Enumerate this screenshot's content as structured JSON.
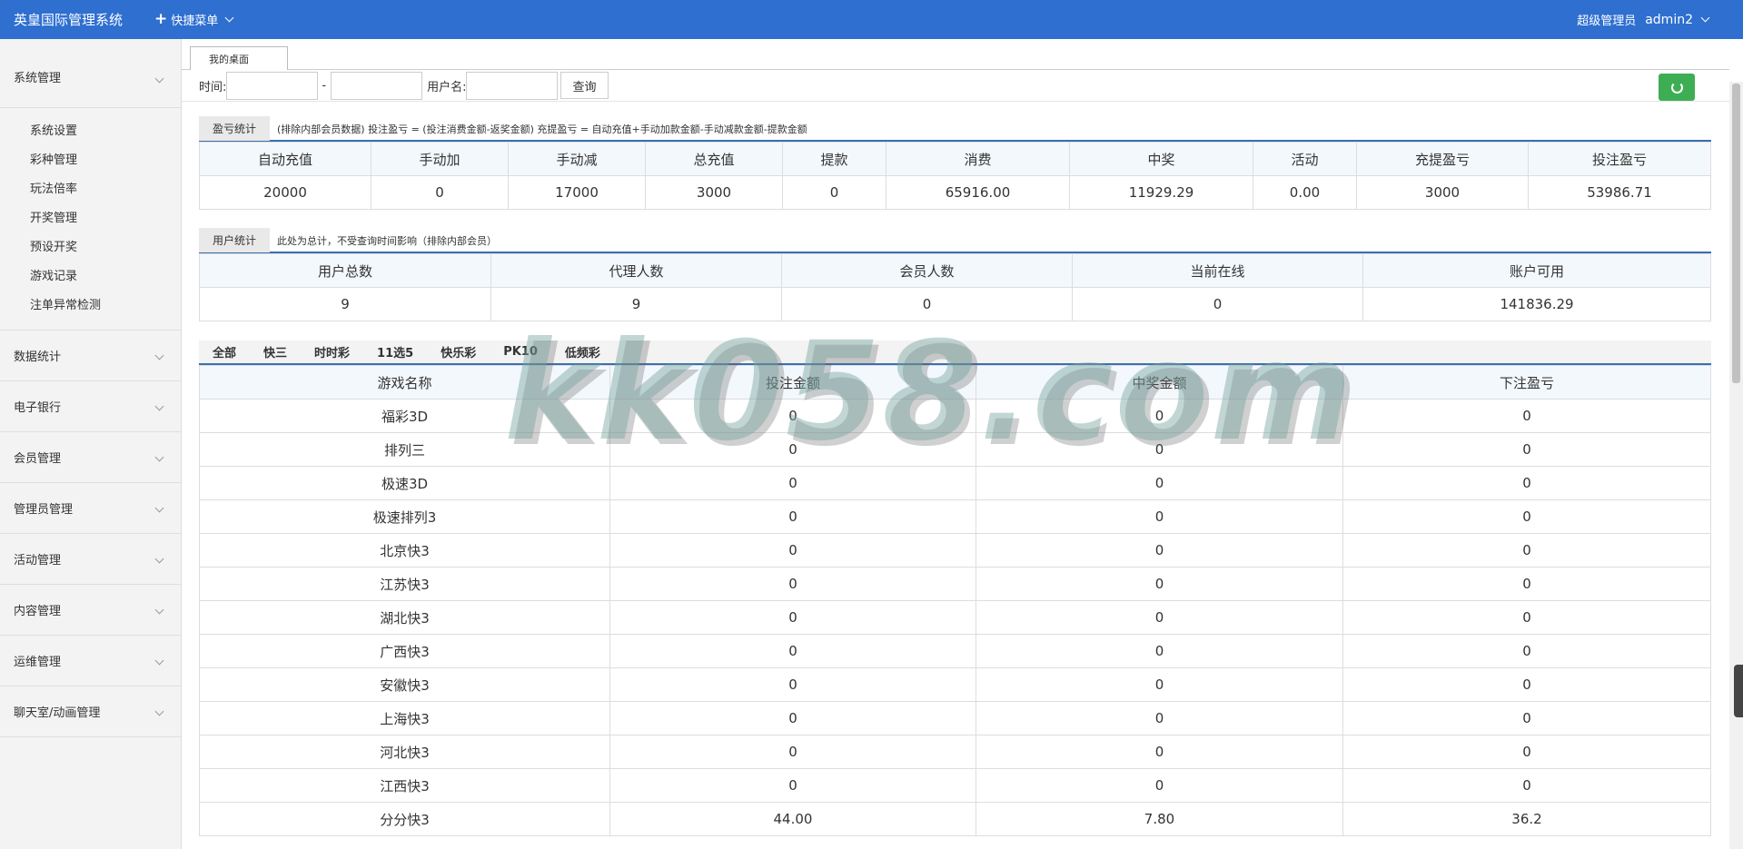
{
  "app": {
    "title": "英皇国际管理系统",
    "quick_menu": "快捷菜单",
    "role": "超级管理员",
    "user": "admin2"
  },
  "sidebar": {
    "groups": [
      "系统管理",
      "数据统计",
      "电子银行",
      "会员管理",
      "管理员管理",
      "活动管理",
      "内容管理",
      "运维管理",
      "聊天室/动画管理"
    ],
    "sub_items": [
      "系统设置",
      "彩种管理",
      "玩法倍率",
      "开奖管理",
      "预设开奖",
      "游戏记录",
      "注单异常检测"
    ]
  },
  "tab": {
    "label": "我的桌面"
  },
  "filter": {
    "time_label": "时间:",
    "dash": "-",
    "user_label": "用户名:",
    "query_button": "查询"
  },
  "profit": {
    "label": "盈亏统计",
    "note": "(排除内部会员数据)  投注盈亏 = (投注消费金额-返奖金额)    充提盈亏 = 自动充值+手动加款金额-手动减款金额-提款金额",
    "headers": [
      "自动充值",
      "手动加",
      "手动减",
      "总充值",
      "提款",
      "消费",
      "中奖",
      "活动",
      "充提盈亏",
      "投注盈亏"
    ],
    "values": [
      "20000",
      "0",
      "17000",
      "3000",
      "0",
      "65916.00",
      "11929.29",
      "0.00",
      "3000",
      "53986.71"
    ]
  },
  "users": {
    "label": "用户统计",
    "note": "此处为总计，不受查询时间影响（排除内部会员）",
    "headers": [
      "用户总数",
      "代理人数",
      "会员人数",
      "当前在线",
      "账户可用"
    ],
    "values": [
      "9",
      "9",
      "0",
      "0",
      "141836.29"
    ]
  },
  "game_tabs": [
    "全部",
    "快三",
    "时时彩",
    "11选5",
    "快乐彩",
    "PK10",
    "低频彩"
  ],
  "games": {
    "headers": [
      "游戏名称",
      "投注金额",
      "中奖金额",
      "下注盈亏"
    ],
    "rows": [
      [
        "福彩3D",
        "0",
        "0",
        "0"
      ],
      [
        "排列三",
        "0",
        "0",
        "0"
      ],
      [
        "极速3D",
        "0",
        "0",
        "0"
      ],
      [
        "极速排列3",
        "0",
        "0",
        "0"
      ],
      [
        "北京快3",
        "0",
        "0",
        "0"
      ],
      [
        "江苏快3",
        "0",
        "0",
        "0"
      ],
      [
        "湖北快3",
        "0",
        "0",
        "0"
      ],
      [
        "广西快3",
        "0",
        "0",
        "0"
      ],
      [
        "安徽快3",
        "0",
        "0",
        "0"
      ],
      [
        "上海快3",
        "0",
        "0",
        "0"
      ],
      [
        "河北快3",
        "0",
        "0",
        "0"
      ],
      [
        "江西快3",
        "0",
        "0",
        "0"
      ],
      [
        "分分快3",
        "44.00",
        "7.80",
        "36.2"
      ]
    ]
  },
  "watermark": "kk058.com",
  "colors": {
    "topbar": "#2e6fd0",
    "accent_border": "#3a6fb0",
    "refresh_button": "#3eae54"
  }
}
